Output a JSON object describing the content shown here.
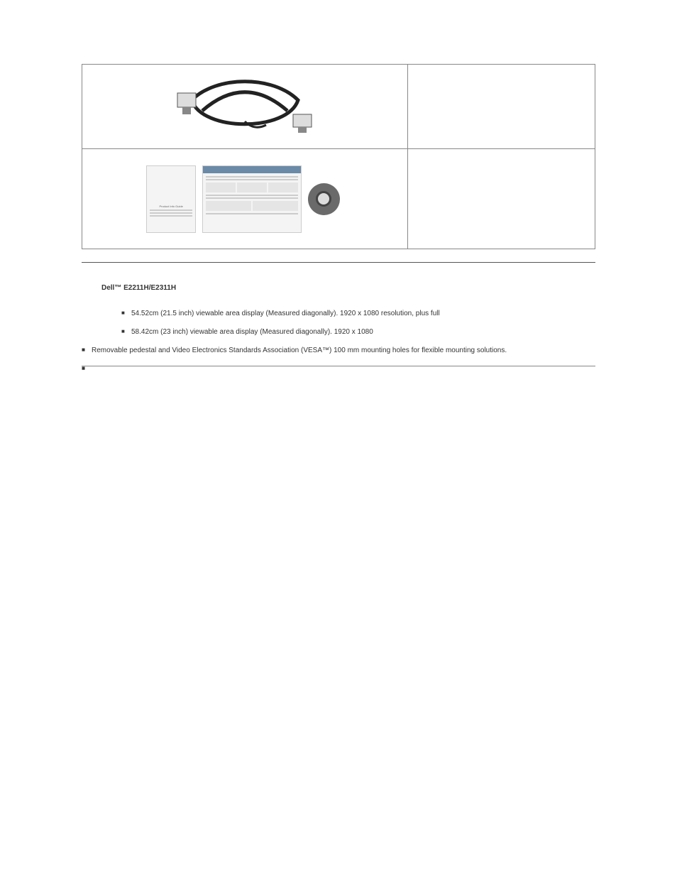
{
  "table": {
    "row1": {
      "desc": ""
    },
    "row2": {
      "desc": ""
    }
  },
  "heading": "Dell™ E2211H/E2311H",
  "features": {
    "f1": "54.52cm (21.5 inch) viewable area display (Measured diagonally).  1920 x 1080 resolution, plus full",
    "f2": "58.42cm (23 inch) viewable area display (Measured diagonally).  1920 x 1080",
    "f3": "",
    "f4": "",
    "f5": "Removable pedestal and Video Electronics Standards Association (VESA™) 100 mm mounting holes for flexible mounting solutions.",
    "f6": "",
    "f7": "",
    "f8": "",
    "f9": "",
    "f10": "",
    "f11": "",
    "f12": "",
    "f13": "",
    "f14": "",
    "f15": "",
    "f16": "",
    "f17": ""
  }
}
